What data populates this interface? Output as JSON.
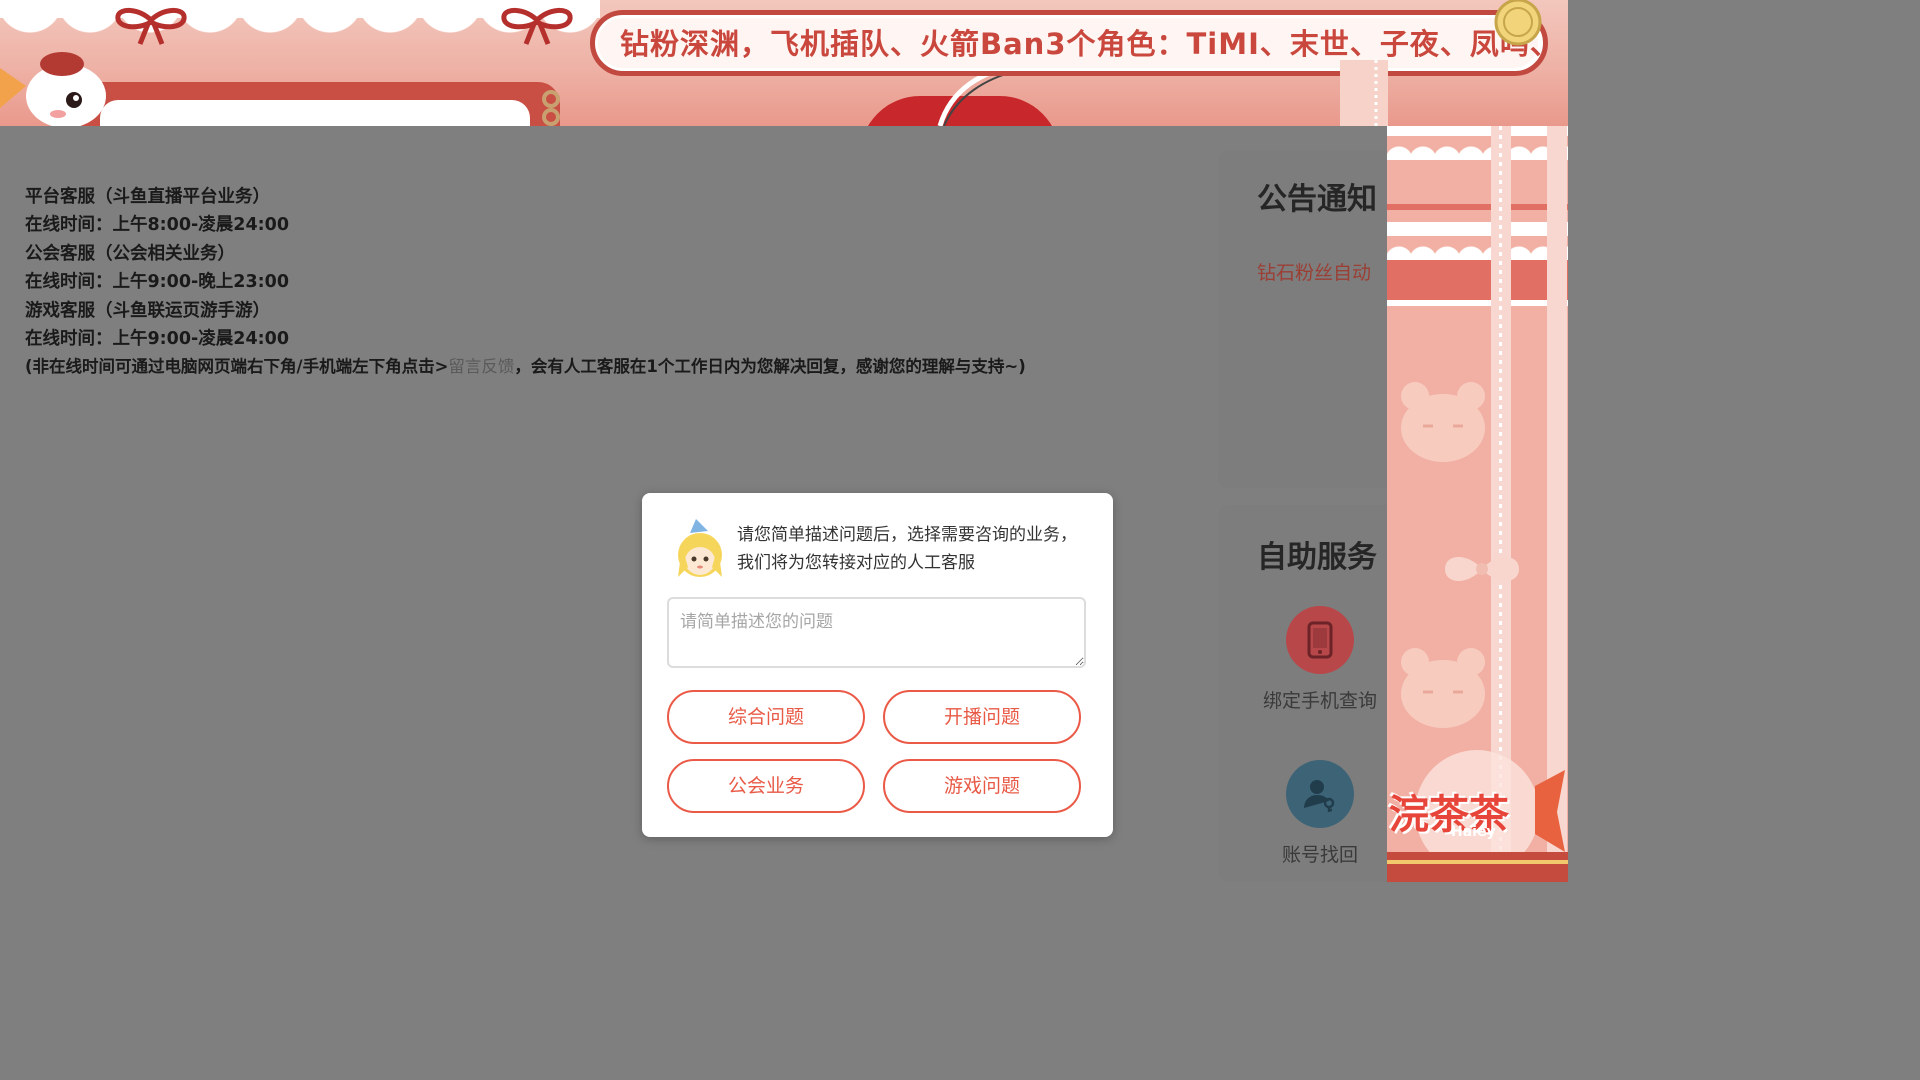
{
  "overlay": {
    "marquee_text": "钻粉深渊，飞机插队、火箭Ban3个角色：TiMI、末世、子夜、凤鸣、",
    "logo_text": "浣茶茶",
    "logo_subtext": "Haiey"
  },
  "service_info": {
    "lines": [
      "平台客服（斗鱼直播平台业务）",
      "在线时间：上午8:00-凌晨24:00",
      "公会客服（公会相关业务）",
      "在线时间：上午9:00-晚上23:00",
      "游戏客服（斗鱼联运页游手游）",
      "在线时间：上午9:00-凌晨24:00"
    ],
    "note_prefix": "(非在线时间可通过电脑网页端右下角/手机端左下角点击>",
    "feedback_link": "留言反馈",
    "note_suffix": "，会有人工客服在1个工作日内为您解决回复，感谢您的理解与支持~)"
  },
  "sidebar": {
    "announcement_title": "公告通知",
    "announcement_text": "钻石粉丝自动",
    "self_service_title": "自助服务",
    "items": [
      {
        "label": "绑定手机查询",
        "icon": "phone-icon",
        "color": "#c73a3f"
      },
      {
        "label": "账号找回",
        "icon": "user-key-icon",
        "color": "#2e6f8f"
      }
    ]
  },
  "modal": {
    "prompt": "请您简单描述问题后，选择需要咨询的业务，我们将为您转接对应的人工客服",
    "textarea_value": "",
    "textarea_placeholder": "请简单描述您的问题",
    "buttons": [
      {
        "label": "综合问题"
      },
      {
        "label": "开播问题"
      },
      {
        "label": "公会业务"
      },
      {
        "label": "游戏问题"
      }
    ],
    "accent_color": "#e85a46"
  },
  "colors": {
    "dim_background": "#7f7f7f",
    "banner_red": "#c24940",
    "banner_pink": "#f1b0a3"
  }
}
